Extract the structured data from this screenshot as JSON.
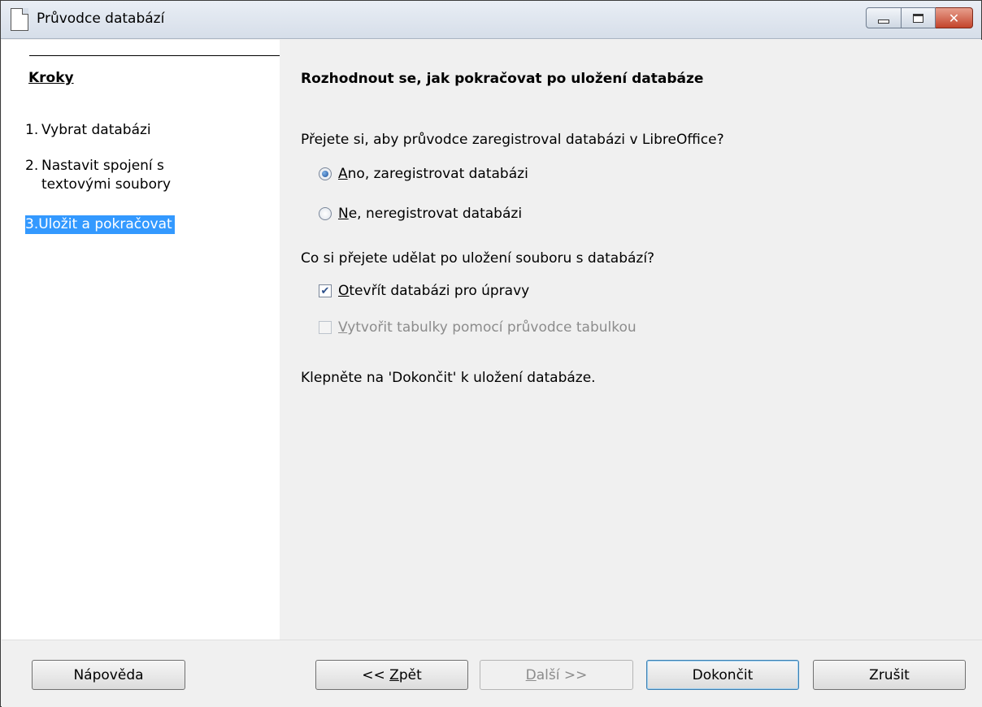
{
  "window": {
    "title": "Průvodce databází"
  },
  "steps": {
    "title": "Kroky",
    "items": [
      {
        "num": "1.",
        "label": "Vybrat databázi"
      },
      {
        "num": "2.",
        "label": "Nastavit spojení s textovými soubory"
      },
      {
        "num": "3.",
        "label": "Uložit a pokračovat",
        "active": true
      }
    ]
  },
  "main": {
    "heading": "Rozhodnout se, jak pokračovat po uložení databáze",
    "register_question": "Přejete si, aby průvodce zaregistroval databázi v LibreOffice?",
    "register_yes": {
      "mnemonic": "A",
      "rest": "no, zaregistrovat databázi",
      "selected": true
    },
    "register_no": {
      "mnemonic": "N",
      "rest": "e, neregistrovat databázi",
      "selected": false
    },
    "after_question": "Co si přejete udělat po uložení souboru s databází?",
    "open_edit": {
      "mnemonic": "O",
      "rest": "tevřít databázi pro úpravy",
      "checked": true
    },
    "create_tables": {
      "mnemonic": "V",
      "rest": "ytvořit tabulky pomocí průvodce tabulkou",
      "checked": false,
      "disabled": true
    },
    "finish_note": "Klepněte na 'Dokončit' k uložení databáze."
  },
  "buttons": {
    "help": "Nápověda",
    "back_prefix": "<< ",
    "back_mnemonic": "Z",
    "back_rest": "pět",
    "next_mnemonic": "D",
    "next_rest": "alší >>",
    "finish": "Dokončit",
    "cancel": "Zrušit"
  },
  "colors": {
    "selection": "#3399ff",
    "dialog_bg": "#f0f0f0"
  }
}
